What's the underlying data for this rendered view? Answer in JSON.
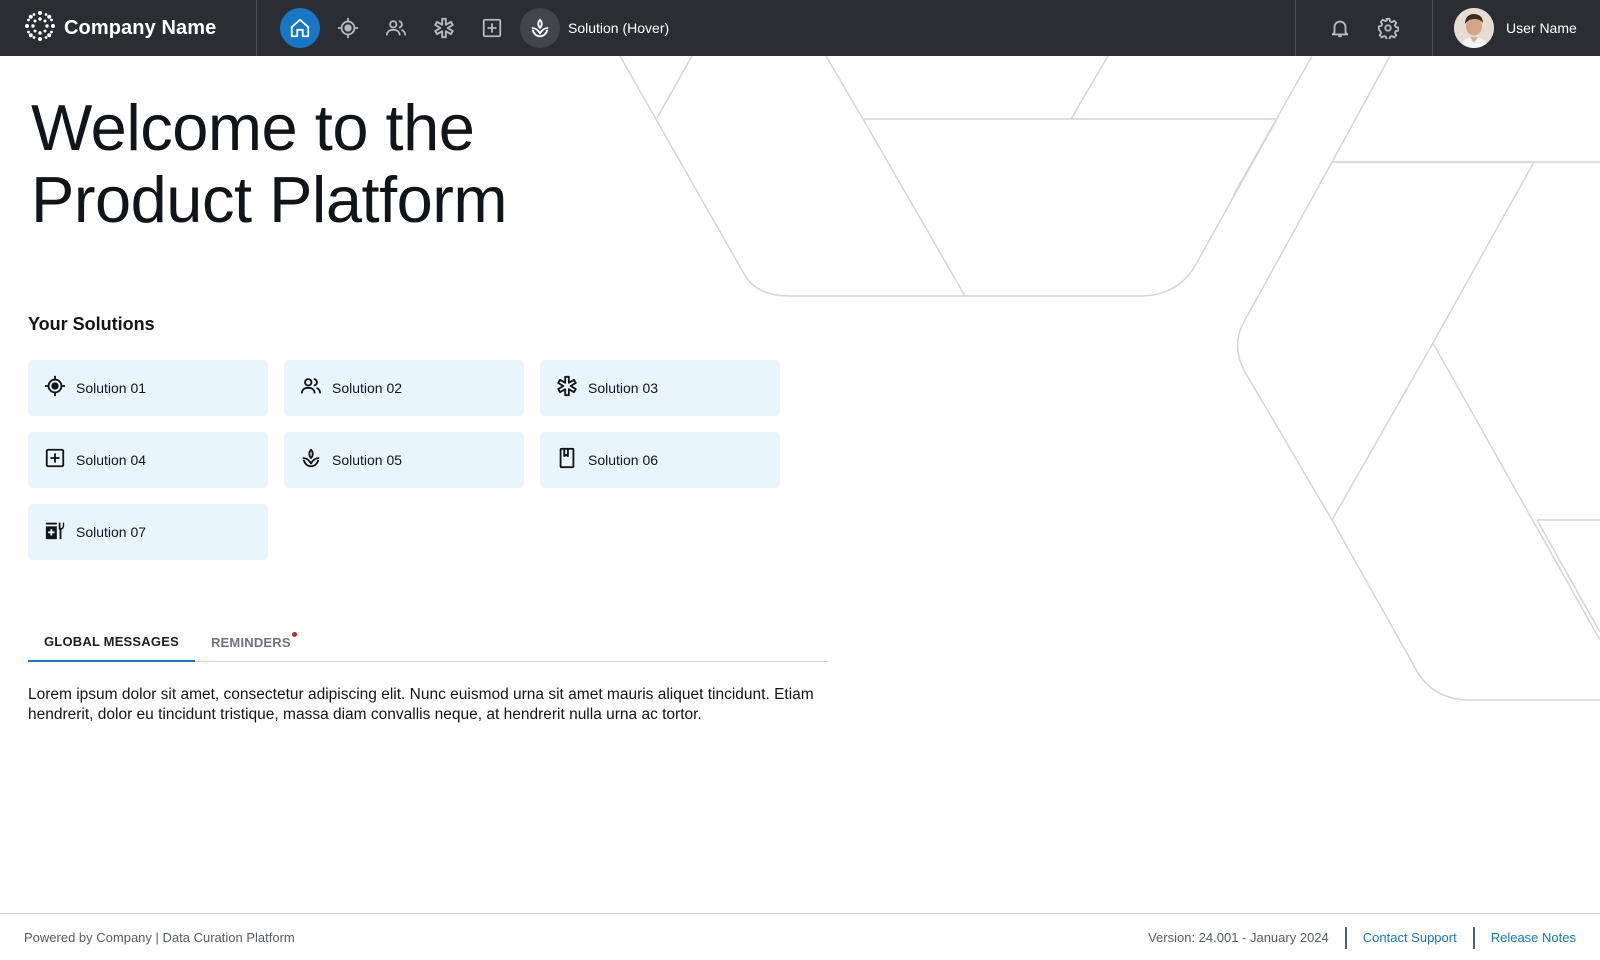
{
  "header": {
    "company_name": "Company Name",
    "hover_label": "Solution (Hover)",
    "user_name": "User Name",
    "icons": [
      "company-logo-icon",
      "home-icon",
      "target-icon",
      "people-icon",
      "asterisk-icon",
      "plus-square-icon",
      "plant-icon",
      "bell-icon",
      "gear-icon"
    ]
  },
  "hero": {
    "line1": "Welcome to the",
    "line2": "Product Platform"
  },
  "solutions": {
    "title": "Your Solutions",
    "items": [
      {
        "label": "Solution 01",
        "icon": "target-icon"
      },
      {
        "label": "Solution 02",
        "icon": "people-icon"
      },
      {
        "label": "Solution 03",
        "icon": "asterisk-icon"
      },
      {
        "label": "Solution 04",
        "icon": "plus-square-icon"
      },
      {
        "label": "Solution 05",
        "icon": "plant-icon"
      },
      {
        "label": "Solution 06",
        "icon": "bookmark-icon"
      },
      {
        "label": "Solution 07",
        "icon": "medical-kit-icon"
      }
    ]
  },
  "tabs": [
    {
      "label": "GLOBAL MESSAGES",
      "active": true
    },
    {
      "label": "REMINDERS",
      "active": false,
      "has_notification": true
    }
  ],
  "message": "Lorem ipsum dolor sit amet, consectetur adipiscing elit. Nunc euismod urna sit amet mauris aliquet tincidunt. Etiam hendrerit, dolor eu tincidunt tristique, massa diam convallis neque, at hendrerit nulla urna ac tortor.",
  "footer": {
    "left": "Powered by Company | Data Curation Platform",
    "version": "Version: 24.001 - January 2024",
    "contact": "Contact Support",
    "release_notes": "Release Notes"
  },
  "colors": {
    "header_bg": "#2a2e33",
    "accent": "#1677c7",
    "card_bg": "#e9f5fc",
    "notification": "#d4212c"
  }
}
